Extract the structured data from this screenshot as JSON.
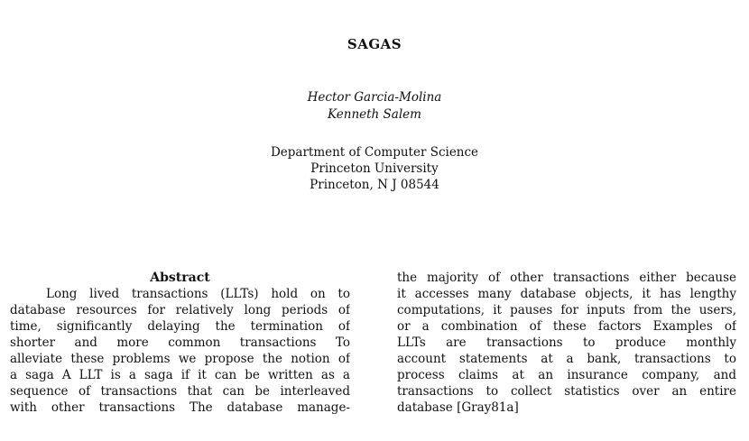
{
  "title": "SAGAS",
  "authors": [
    "Hector Garcia-Molina",
    "Kenneth Salem"
  ],
  "affiliation": [
    "Department of Computer Science",
    "Princeton University",
    "Princeton, N J 08544"
  ],
  "abstract": {
    "heading": "Abstract",
    "left_lines": [
      "Long lived transactions (LLTs) hold on to",
      "database resources for relatively long periods of",
      "time, significantly delaying the termination of",
      "shorter and more common transactions  To",
      "alleviate these problems we propose the notion of",
      "a saga  A LLT is a saga if it can be written as a",
      "sequence of transactions that can be interleaved",
      "with other transactions  The database manage-"
    ],
    "right_lines": [
      "the majority of other transactions either because",
      "it accesses many database objects, it has lengthy",
      "computations, it pauses for inputs from the users,",
      "or a combination of these factors  Examples of",
      "LLTs are transactions to produce monthly",
      "account statements at a bank, transactions to",
      "process claims at an insurance company, and",
      "transactions to collect statistics over an entire",
      "database [Gray81a]"
    ]
  }
}
